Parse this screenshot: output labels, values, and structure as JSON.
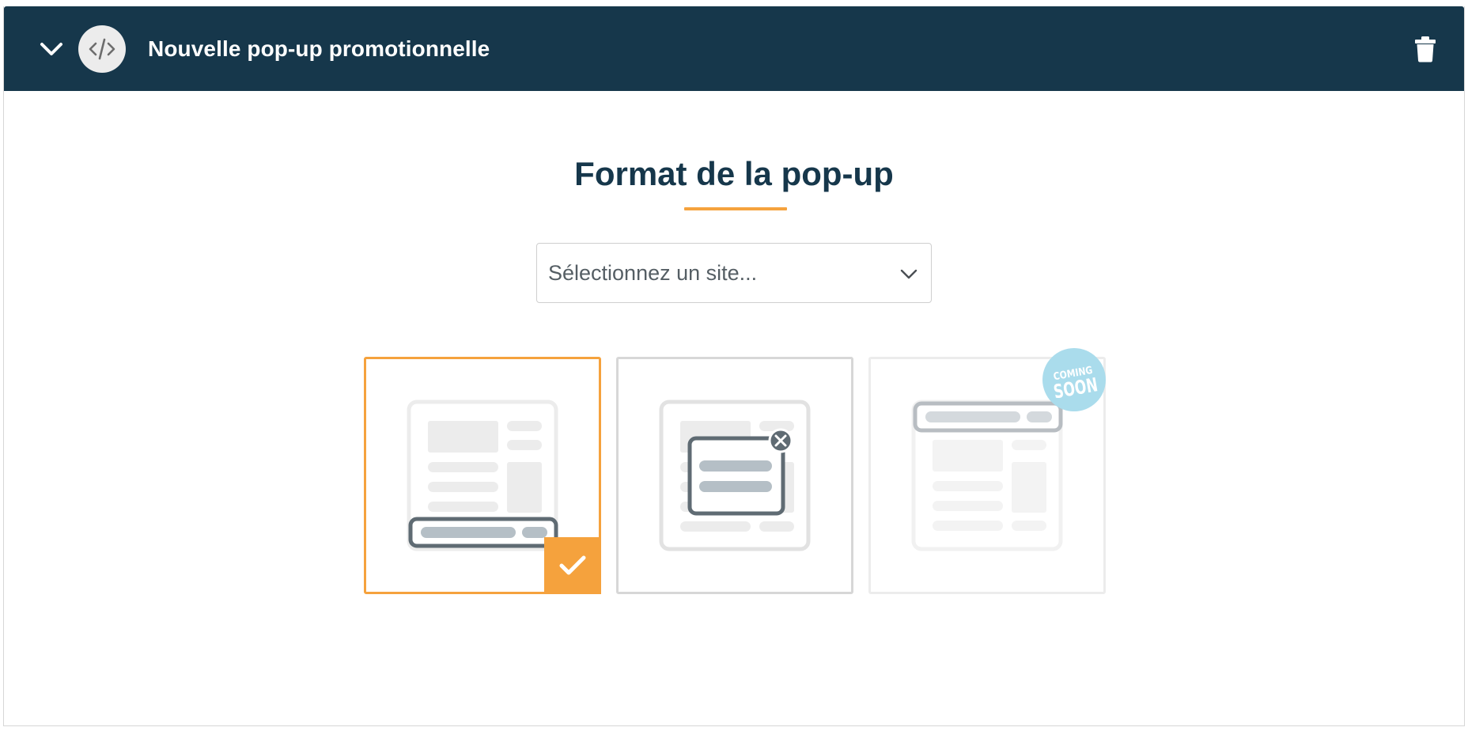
{
  "header": {
    "title": "Nouvelle pop-up promotionnelle",
    "background_color": "#16374b",
    "collapse_icon": "chevron-down-icon",
    "type_icon": "code-icon",
    "delete_icon": "trash-icon"
  },
  "main": {
    "section_title": "Format de la pop-up",
    "underline_color": "#f5a23d",
    "site_select": {
      "placeholder": "Sélectionnez un site...",
      "icon": "chevron-down-icon"
    },
    "formats": [
      {
        "id": "bottom-banner",
        "selected": true,
        "available": true,
        "icon": "bottom-bar-layout-icon"
      },
      {
        "id": "center-modal",
        "selected": false,
        "available": true,
        "icon": "modal-layout-icon"
      },
      {
        "id": "top-banner",
        "selected": false,
        "available": false,
        "icon": "top-bar-layout-icon",
        "badge": {
          "line1": "COMING",
          "line2": "SOON"
        }
      }
    ],
    "selected_badge_icon": "check-icon",
    "accent_color": "#f5a23d",
    "badge_color": "#aadcec"
  }
}
